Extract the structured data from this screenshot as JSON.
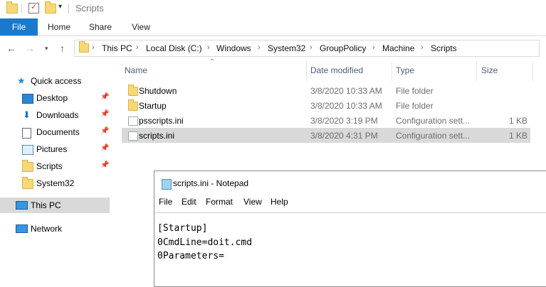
{
  "window": {
    "title": "Scripts"
  },
  "ribbon": {
    "tabs": [
      "File",
      "Home",
      "Share",
      "View"
    ]
  },
  "address": {
    "crumbs": [
      "This PC",
      "Local Disk (C:)",
      "Windows",
      "System32",
      "GroupPolicy",
      "Machine",
      "Scripts"
    ]
  },
  "nav": {
    "quick_access": "Quick access",
    "items": [
      {
        "label": "Desktop",
        "icon": "desktop-icon"
      },
      {
        "label": "Downloads",
        "icon": "download-icon"
      },
      {
        "label": "Documents",
        "icon": "document-icon"
      },
      {
        "label": "Pictures",
        "icon": "pictures-icon"
      },
      {
        "label": "Scripts",
        "icon": "folder-icon"
      },
      {
        "label": "System32",
        "icon": "folder-icon"
      }
    ],
    "this_pc": "This PC",
    "network": "Network"
  },
  "columns": {
    "name": "Name",
    "date": "Date modified",
    "type": "Type",
    "size": "Size"
  },
  "files": [
    {
      "name": "Shutdown",
      "date": "3/8/2020 10:33 AM",
      "type": "File folder",
      "size": "",
      "icon": "folder-icon"
    },
    {
      "name": "Startup",
      "date": "3/8/2020 10:33 AM",
      "type": "File folder",
      "size": "",
      "icon": "folder-icon"
    },
    {
      "name": "psscripts.ini",
      "date": "3/8/2020 3:19 PM",
      "type": "Configuration sett...",
      "size": "1 KB",
      "icon": "config-file-icon"
    },
    {
      "name": "scripts.ini",
      "date": "3/8/2020 4:31 PM",
      "type": "Configuration sett...",
      "size": "1 KB",
      "icon": "config-file-icon"
    }
  ],
  "notepad": {
    "title": "scripts.ini - Notepad",
    "menu": [
      "File",
      "Edit",
      "Format",
      "View",
      "Help"
    ],
    "lines": [
      "[Startup]",
      "0CmdLine=doit.cmd",
      "0Parameters="
    ]
  },
  "colors": {
    "accent": "#1979ca",
    "selected_row": "#d9d9d9",
    "folder": "#f8d775"
  }
}
